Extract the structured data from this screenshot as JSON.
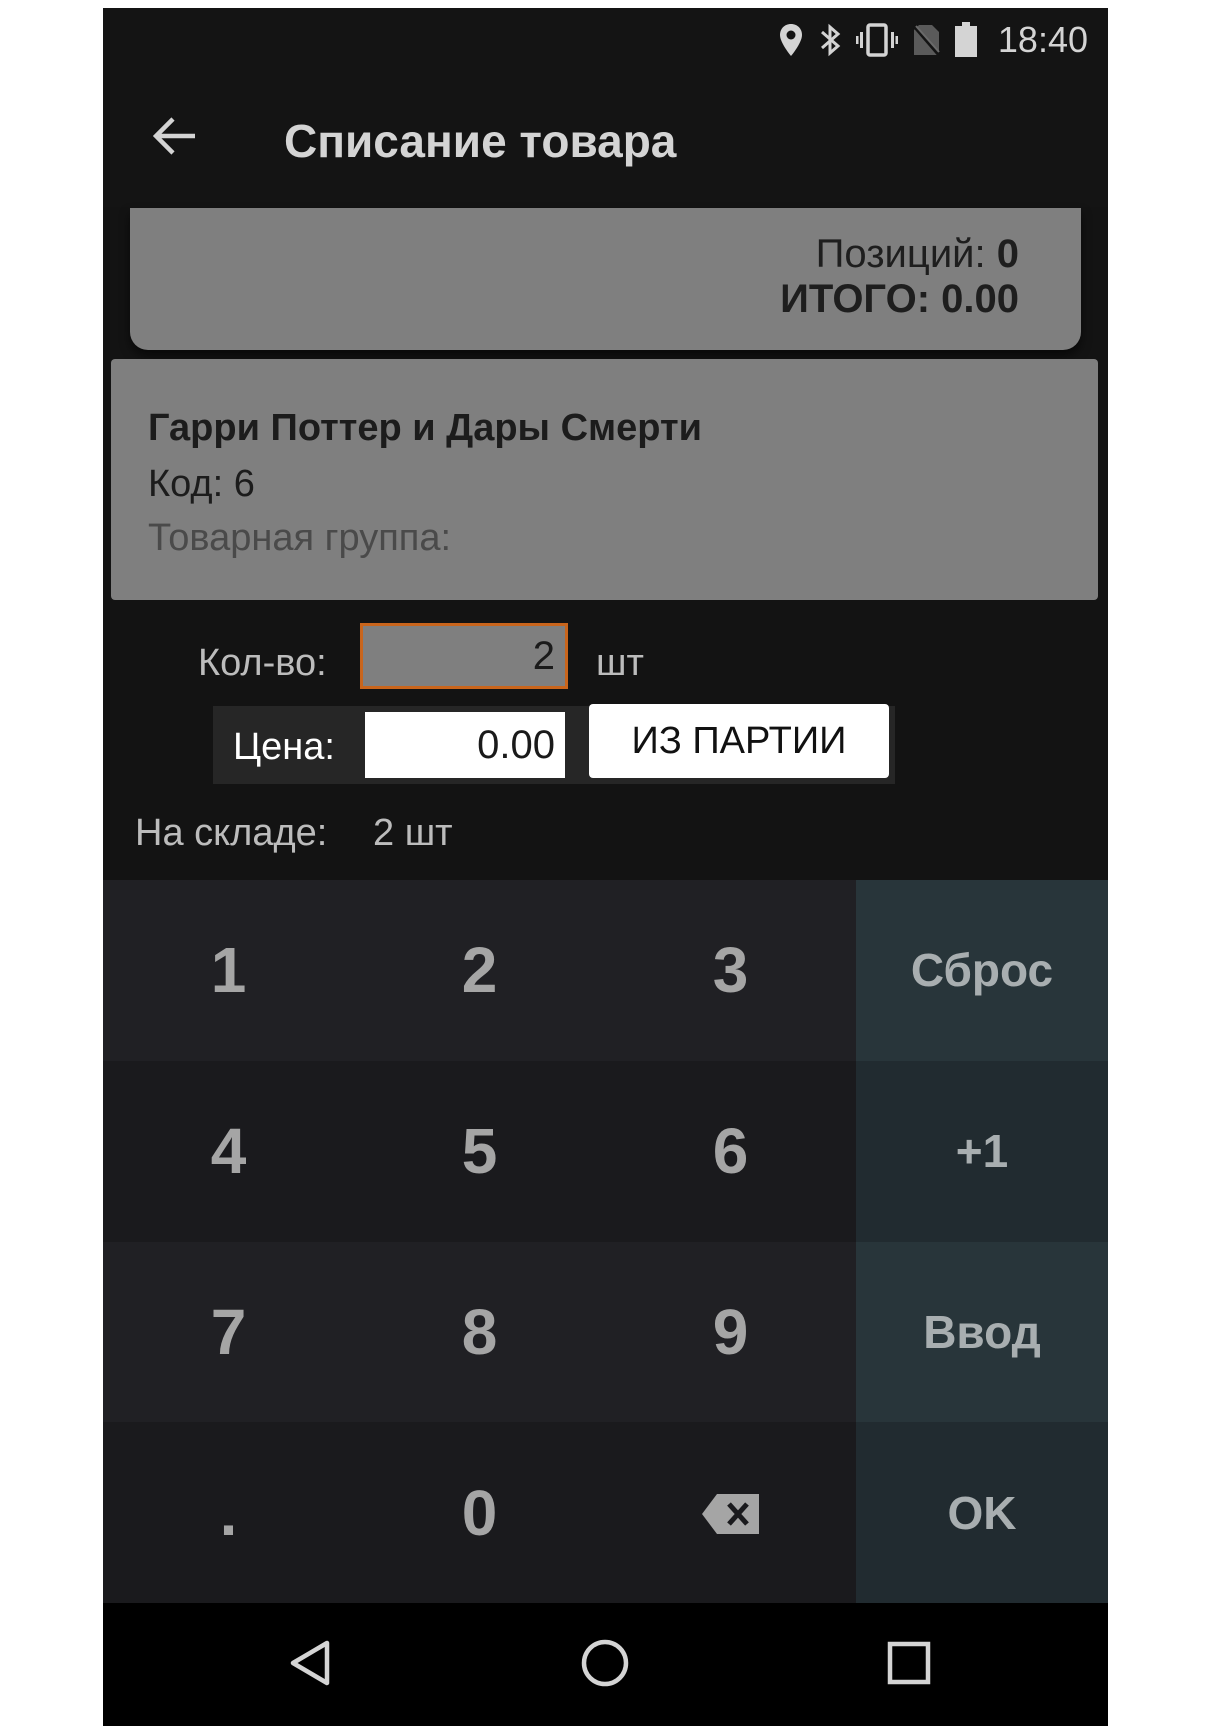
{
  "status_bar": {
    "time": "18:40",
    "icons": [
      "location-icon",
      "bluetooth-icon",
      "vibrate-icon",
      "no-sim-icon",
      "battery-icon"
    ]
  },
  "toolbar": {
    "back_icon": "arrow-left-icon",
    "title": "Списание товара"
  },
  "summary": {
    "positions_label": "Позиций:",
    "positions_value": "0",
    "total_label": "ИТОГО:",
    "total_value": "0.00"
  },
  "product": {
    "name": "Гарри Поттер и Дары Смерти",
    "code": "Код: 6",
    "group": "Товарная группа:"
  },
  "form": {
    "qty_label": "Кол-во:",
    "qty_value": "2",
    "qty_unit": "шт",
    "price_label": "Цена:",
    "price_value": "0.00",
    "batch_button": "ИЗ ПАРТИИ",
    "stock_label": "На складе:",
    "stock_value": "2 шт"
  },
  "keypad": {
    "keys": [
      "1",
      "2",
      "3",
      "4",
      "5",
      "6",
      "7",
      "8",
      "9",
      ".",
      "0"
    ],
    "backspace_icon": "backspace-icon",
    "reset": "Сброс",
    "plus_one": "+1",
    "enter": "Ввод",
    "ok": "OK"
  },
  "nav_bar": {
    "icons": [
      "back-triangle-icon",
      "home-circle-icon",
      "recents-square-icon"
    ]
  },
  "colors": {
    "background": "#131313",
    "card": "#7f7f7f",
    "accent_border": "#c9651c",
    "keypad_fn": "#28353a"
  }
}
